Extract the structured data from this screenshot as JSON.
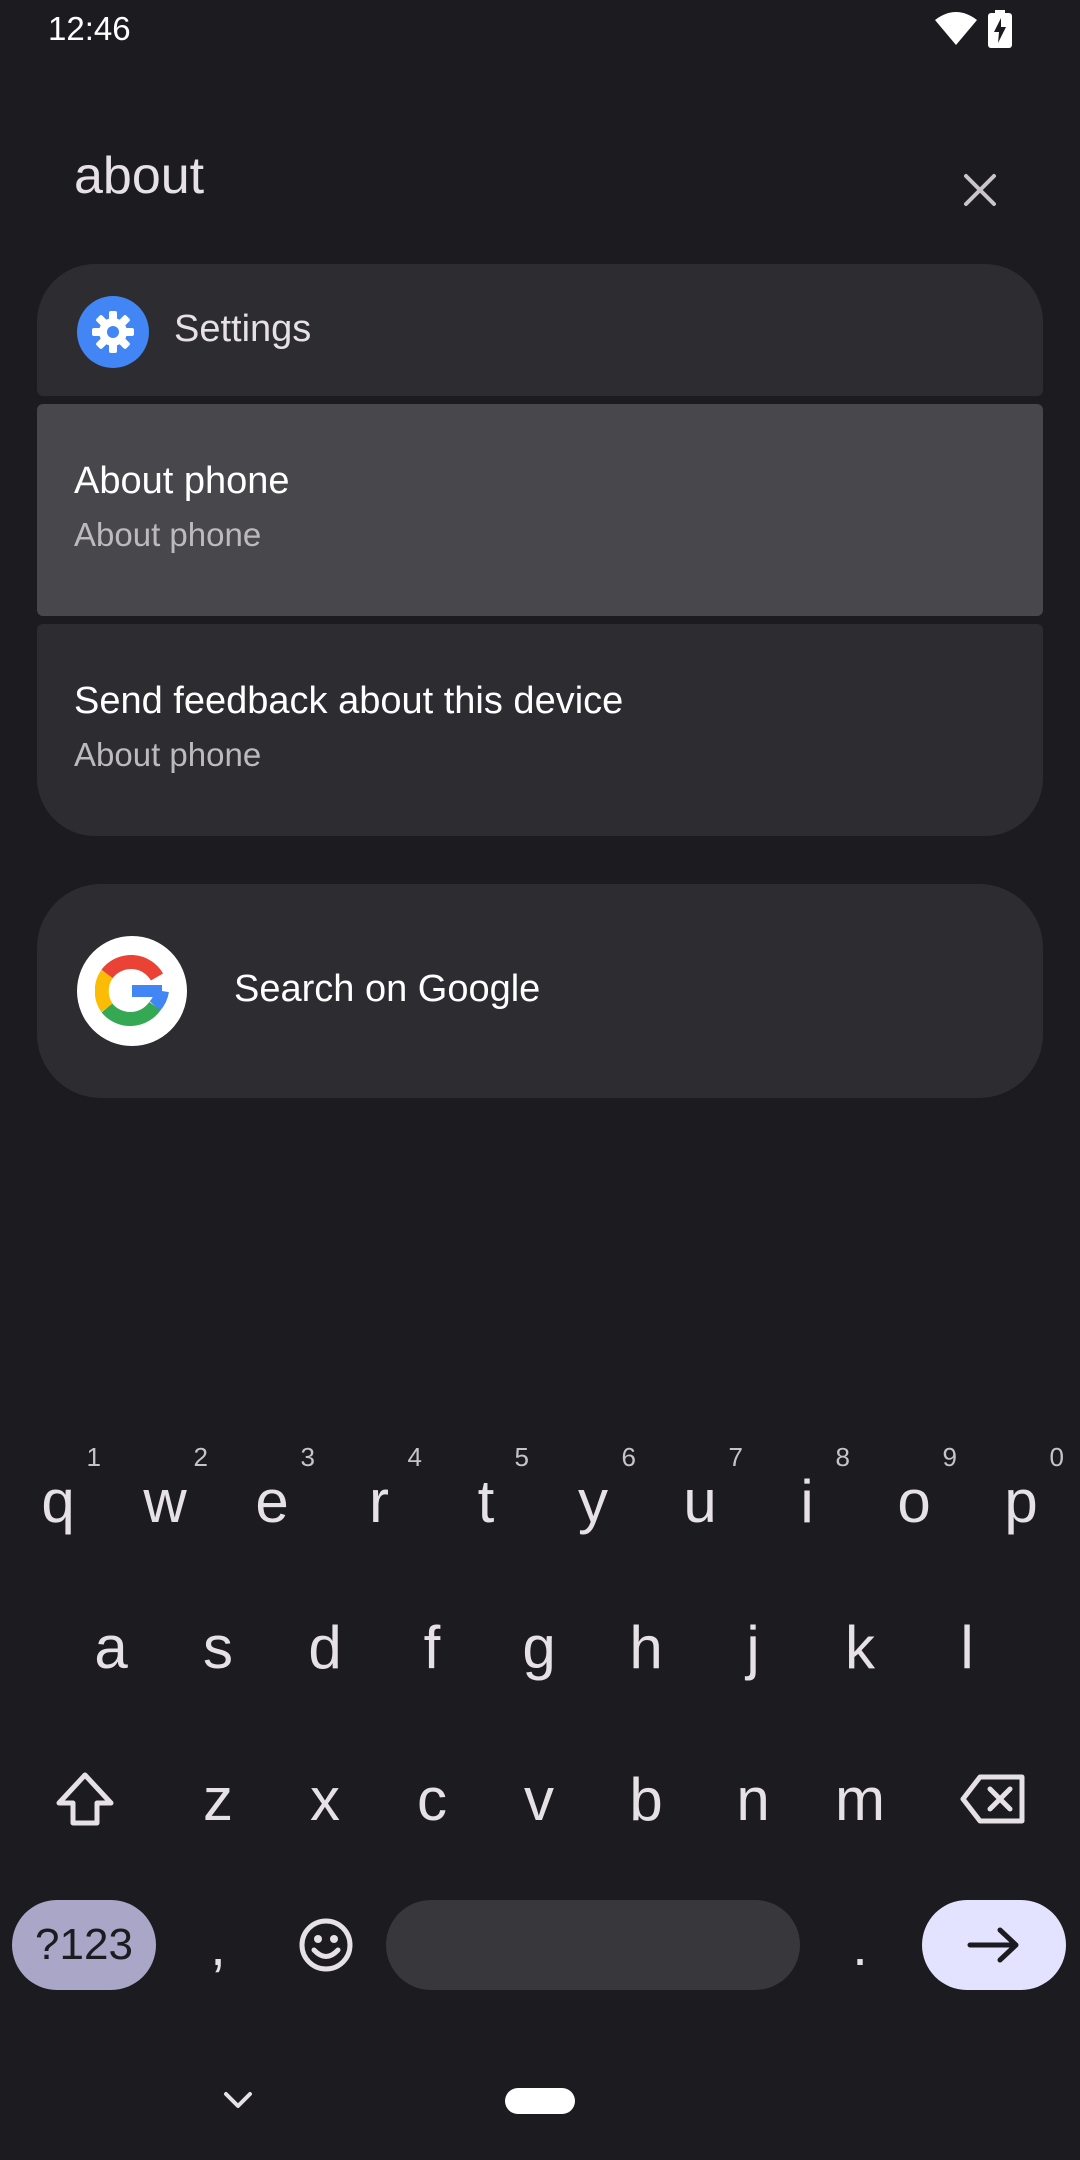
{
  "status_bar": {
    "time": "12:46"
  },
  "search": {
    "query": "about"
  },
  "results": {
    "app_name": "Settings",
    "items": [
      {
        "title": "About phone",
        "subtitle": "About phone"
      },
      {
        "title": "Send feedback about this device",
        "subtitle": "About phone"
      }
    ]
  },
  "web_search": {
    "label": "Search on Google"
  },
  "keyboard": {
    "row1": [
      {
        "k": "q",
        "h": "1"
      },
      {
        "k": "w",
        "h": "2"
      },
      {
        "k": "e",
        "h": "3"
      },
      {
        "k": "r",
        "h": "4"
      },
      {
        "k": "t",
        "h": "5"
      },
      {
        "k": "y",
        "h": "6"
      },
      {
        "k": "u",
        "h": "7"
      },
      {
        "k": "i",
        "h": "8"
      },
      {
        "k": "o",
        "h": "9"
      },
      {
        "k": "p",
        "h": "0"
      }
    ],
    "row2": [
      "a",
      "s",
      "d",
      "f",
      "g",
      "h",
      "j",
      "k",
      "l"
    ],
    "row3": [
      "z",
      "x",
      "c",
      "v",
      "b",
      "n",
      "m"
    ],
    "symbols": "?123",
    "comma": ",",
    "period": "."
  },
  "colors": {
    "background": "#1c1b1f",
    "card": "#2d2c31",
    "highlight": "#48474c",
    "settings_blue": "#4285f4",
    "enter_key": "#e4e3ff"
  }
}
